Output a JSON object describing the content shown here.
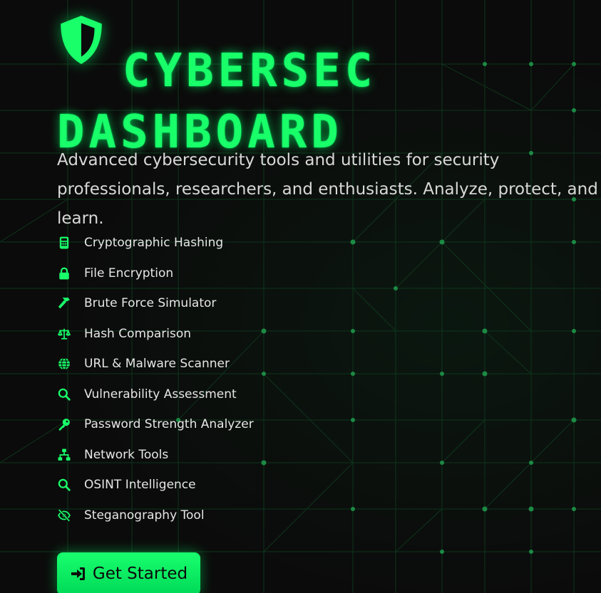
{
  "hero": {
    "title_line1": "CYBERSEC",
    "title_line2": "DASHBOARD",
    "subtitle": "Advanced cybersecurity tools and utilities for security professionals, researchers, and enthusiasts. Analyze, protect, and learn."
  },
  "features": [
    {
      "icon": "calculator-icon",
      "label": "Cryptographic Hashing"
    },
    {
      "icon": "lock-icon",
      "label": "File Encryption"
    },
    {
      "icon": "hammer-icon",
      "label": "Brute Force Simulator"
    },
    {
      "icon": "scale-icon",
      "label": "Hash Comparison"
    },
    {
      "icon": "globe-icon",
      "label": "URL & Malware Scanner"
    },
    {
      "icon": "search-icon",
      "label": "Vulnerability Assessment"
    },
    {
      "icon": "key-icon",
      "label": "Password Strength Analyzer"
    },
    {
      "icon": "network-icon",
      "label": "Network Tools"
    },
    {
      "icon": "search-icon",
      "label": "OSINT Intelligence"
    },
    {
      "icon": "eye-slash-icon",
      "label": "Steganography Tool"
    }
  ],
  "cta": {
    "icon": "sign-in-icon",
    "label": "Get Started"
  },
  "colors": {
    "accent": "#19ff6a",
    "background": "#0b0b0b",
    "text": "#e6e6e6"
  }
}
